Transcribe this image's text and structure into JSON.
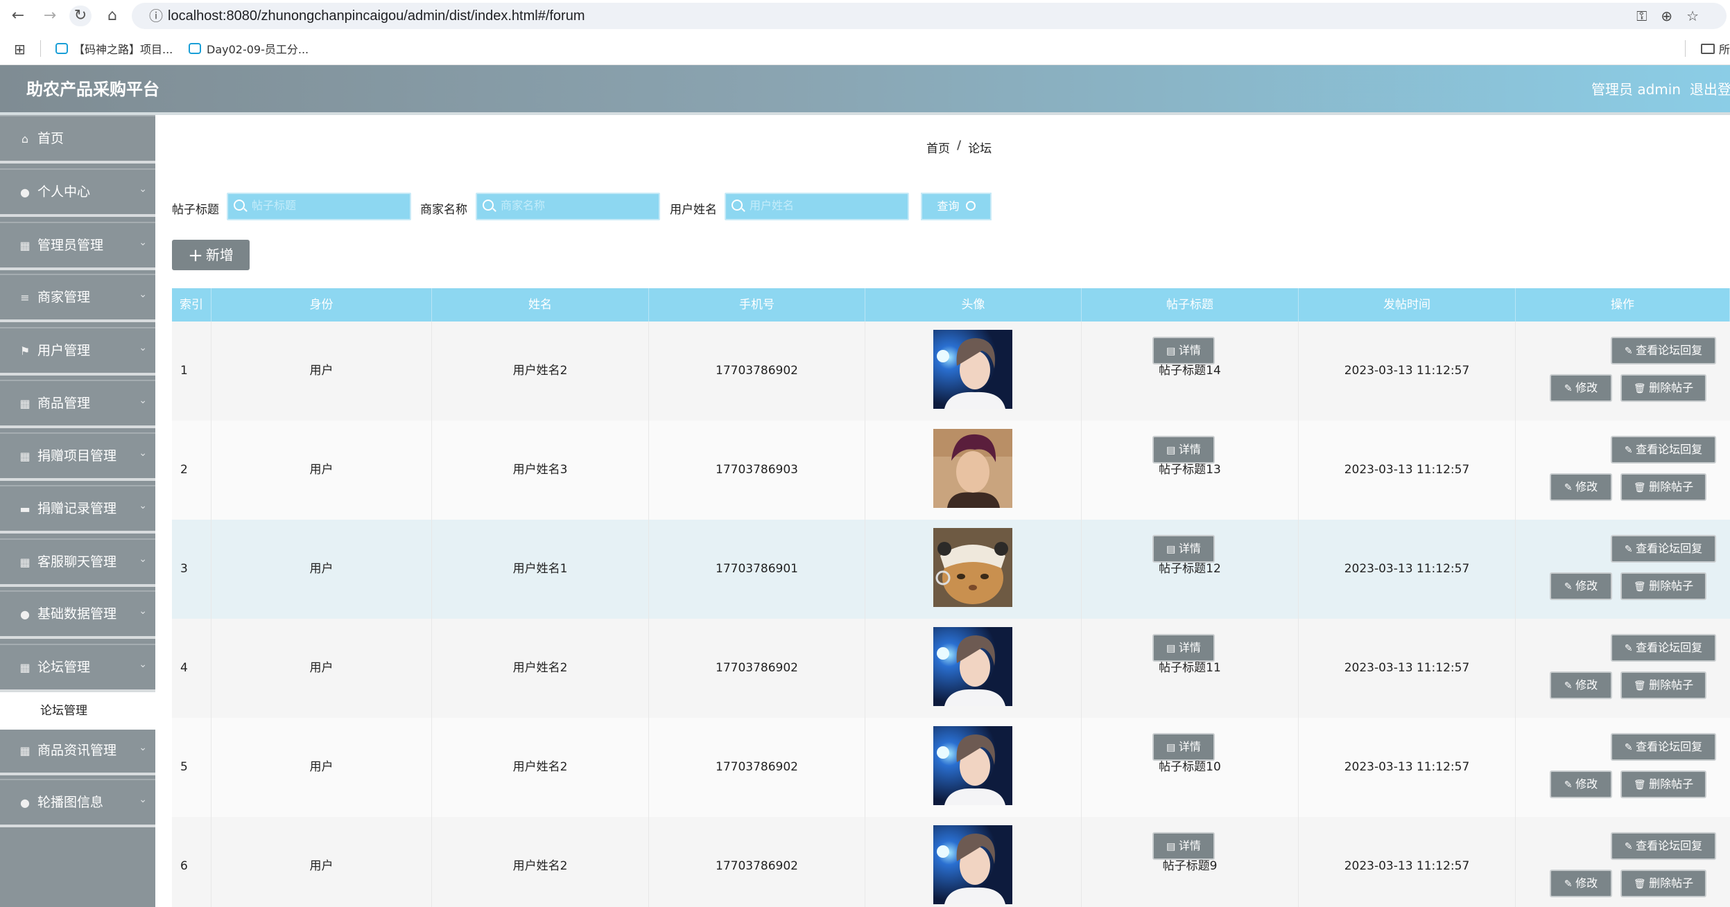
{
  "browser": {
    "url": "localhost:8080/zhunongchanpincaigou/admin/dist/index.html#/forum",
    "bookmarks": [
      "【码神之路】项目...",
      "Day02-09-员工分..."
    ],
    "bookmarks_right": "所"
  },
  "header": {
    "title": "助农产品采购平台",
    "user": "管理员 admin",
    "logout": "退出登录"
  },
  "sidebar": {
    "items": [
      {
        "label": "首页",
        "icon": "home-icon",
        "glyph": "⌂"
      },
      {
        "label": "个人中心",
        "icon": "user-icon",
        "glyph": "●"
      },
      {
        "label": "管理员管理",
        "icon": "grid-icon",
        "glyph": "▦"
      },
      {
        "label": "商家管理",
        "icon": "list-icon",
        "glyph": "≡"
      },
      {
        "label": "用户管理",
        "icon": "flag-icon",
        "glyph": "⚑"
      },
      {
        "label": "商品管理",
        "icon": "grid-icon",
        "glyph": "▦"
      },
      {
        "label": "捐赠项目管理",
        "icon": "grid-icon",
        "glyph": "▦"
      },
      {
        "label": "捐赠记录管理",
        "icon": "ticket-icon",
        "glyph": "▬"
      },
      {
        "label": "客服聊天管理",
        "icon": "grid-icon",
        "glyph": "▦"
      },
      {
        "label": "基础数据管理",
        "icon": "user-icon",
        "glyph": "●"
      },
      {
        "label": "论坛管理",
        "icon": "grid-icon",
        "glyph": "▦"
      },
      {
        "label": "商品资讯管理",
        "icon": "grid-icon",
        "glyph": "▦"
      },
      {
        "label": "轮播图信息",
        "icon": "pin-icon",
        "glyph": "●"
      }
    ],
    "submenu_label": "论坛管理"
  },
  "breadcrumb": {
    "home": "首页",
    "separator": "/",
    "current": "论坛"
  },
  "search": {
    "title_label": "帖子标题",
    "title_placeholder": "帖子标题",
    "merchant_label": "商家名称",
    "merchant_placeholder": "商家名称",
    "user_label": "用户姓名",
    "user_placeholder": "用户姓名",
    "query_label": "查询"
  },
  "add_label": "新增",
  "table": {
    "headers": [
      "索引",
      "身份",
      "姓名",
      "手机号",
      "头像",
      "帖子标题",
      "发帖时间",
      "操作"
    ],
    "rows": [
      {
        "index": "1",
        "role": "用户",
        "name": "用户姓名2",
        "phone": "17703786902",
        "avatar": "young-man-blue",
        "title": "帖子标题14",
        "time": "2023-03-13 11:12:57"
      },
      {
        "index": "2",
        "role": "用户",
        "name": "用户姓名3",
        "phone": "17703786903",
        "avatar": "man-purple-hair",
        "title": "帖子标题13",
        "time": "2023-03-13 11:12:57"
      },
      {
        "index": "3",
        "role": "用户",
        "name": "用户姓名1",
        "phone": "17703786901",
        "avatar": "cat-hat",
        "title": "帖子标题12",
        "time": "2023-03-13 11:12:57"
      },
      {
        "index": "4",
        "role": "用户",
        "name": "用户姓名2",
        "phone": "17703786902",
        "avatar": "young-man-blue",
        "title": "帖子标题11",
        "time": "2023-03-13 11:12:57"
      },
      {
        "index": "5",
        "role": "用户",
        "name": "用户姓名2",
        "phone": "17703786902",
        "avatar": "young-man-blue",
        "title": "帖子标题10",
        "time": "2023-03-13 11:12:57"
      },
      {
        "index": "6",
        "role": "用户",
        "name": "用户姓名2",
        "phone": "17703786902",
        "avatar": "young-man-blue",
        "title": "帖子标题9",
        "time": "2023-03-13 11:12:57"
      }
    ],
    "actions": {
      "detail": "详情",
      "replies": "查看论坛回复",
      "edit": "修改",
      "delete": "删除帖子"
    }
  },
  "colors": {
    "accent": "#8dd7f1",
    "sidebar": "#8a9499",
    "button": "#7b8589"
  }
}
